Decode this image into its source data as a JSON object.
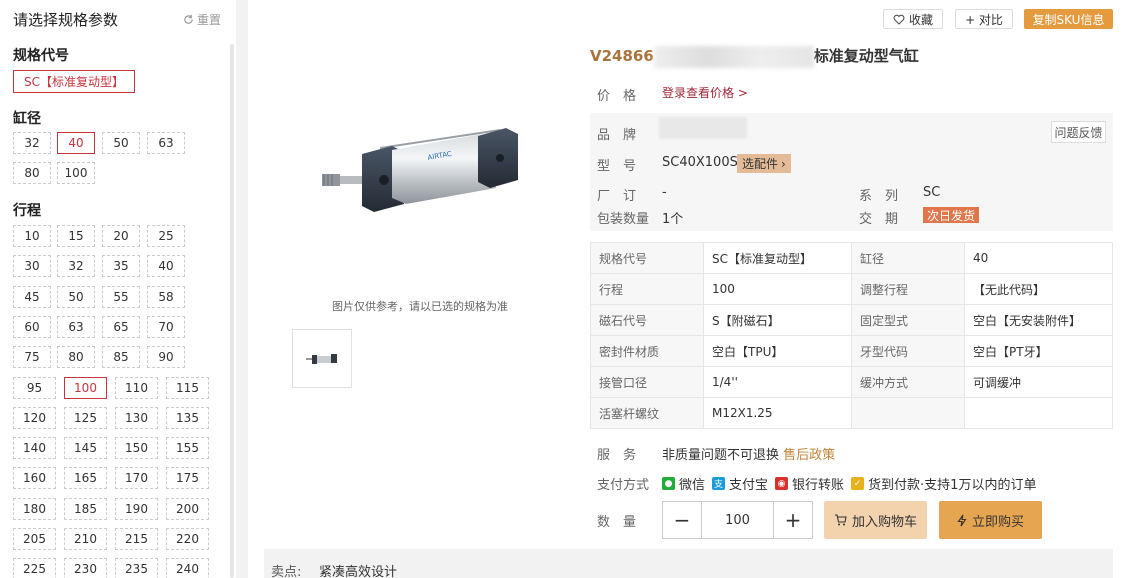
{
  "sidebar": {
    "title": "请选择规格参数",
    "reset_label": "重置",
    "spec_code": {
      "title": "规格代号",
      "options": [
        "SC【标准复动型】"
      ],
      "selected": "SC【标准复动型】"
    },
    "bore": {
      "title": "缸径",
      "options": [
        "32",
        "40",
        "50",
        "63",
        "80",
        "100"
      ],
      "selected": "40"
    },
    "stroke": {
      "title": "行程",
      "options": [
        "10",
        "15",
        "20",
        "25",
        "30",
        "32",
        "35",
        "40",
        "45",
        "50",
        "55",
        "58",
        "60",
        "63",
        "65",
        "70",
        "75",
        "80",
        "85",
        "90",
        "95",
        "100",
        "110",
        "115",
        "120",
        "125",
        "130",
        "135",
        "140",
        "145",
        "150",
        "155",
        "160",
        "165",
        "170",
        "175",
        "180",
        "185",
        "190",
        "200",
        "205",
        "210",
        "215",
        "220",
        "225",
        "230",
        "235",
        "240"
      ],
      "selected": "100"
    }
  },
  "toolbar": {
    "favorite": "收藏",
    "compare": "+ 对比",
    "copy_sku": "复制SKU信息"
  },
  "gallery": {
    "note": "图片仅供参考，请以已选的规格为准"
  },
  "product": {
    "code_prefix": "V24866",
    "title_suffix": "标准复动型气缸",
    "price_label": "价　格",
    "price_link": "登录查看价格 >",
    "brand_label": "品　牌",
    "feedback": "问题反馈",
    "model_label": "型　号",
    "model": "SC40X100S",
    "accessory": "选配件",
    "maker_label": "厂　订",
    "maker": "-",
    "series_label": "系　列",
    "series": "SC",
    "pack_label": "包装数量",
    "pack": "1个",
    "delivery_label": "交　期",
    "delivery": "次日发货"
  },
  "specs": [
    [
      "规格代号",
      "SC【标准复动型】",
      "缸径",
      "40"
    ],
    [
      "行程",
      "100",
      "调整行程",
      "【无此代码】"
    ],
    [
      "磁石代号",
      "S【附磁石】",
      "固定型式",
      "空白【无安装附件】"
    ],
    [
      "密封件材质",
      "空白【TPU】",
      "牙型代码",
      "空白【PT牙】"
    ],
    [
      "接管口径",
      "1/4''",
      "缓冲方式",
      "可调缓冲"
    ],
    [
      "活塞杆螺纹",
      "M12X1.25",
      "",
      ""
    ]
  ],
  "service": {
    "label": "服　务",
    "text": "非质量问题不可退换",
    "link": "售后政策"
  },
  "payment": {
    "label": "支付方式",
    "methods": [
      {
        "name": "微信",
        "color": "#22ac38",
        "icon": "wechat-icon"
      },
      {
        "name": "支付宝",
        "color": "#1a9cdb",
        "icon": "alipay-icon"
      },
      {
        "name": "银行转账",
        "color": "#d9302c",
        "icon": "bank-icon"
      },
      {
        "name": "货到付款·支持1万以内的订单",
        "color": "#e5b21c",
        "icon": "cod-icon"
      }
    ]
  },
  "quantity": {
    "label": "数　量",
    "value": "100"
  },
  "actions": {
    "cart": "加入购物车",
    "buy": "立即购买"
  },
  "selling_point": {
    "label": "卖点:",
    "text": "紧凑高效设计"
  },
  "colors": {
    "accent": "#c8343f",
    "gold": "#e39b3e",
    "cart": "#f2d3ad",
    "buy": "#e6a651"
  }
}
